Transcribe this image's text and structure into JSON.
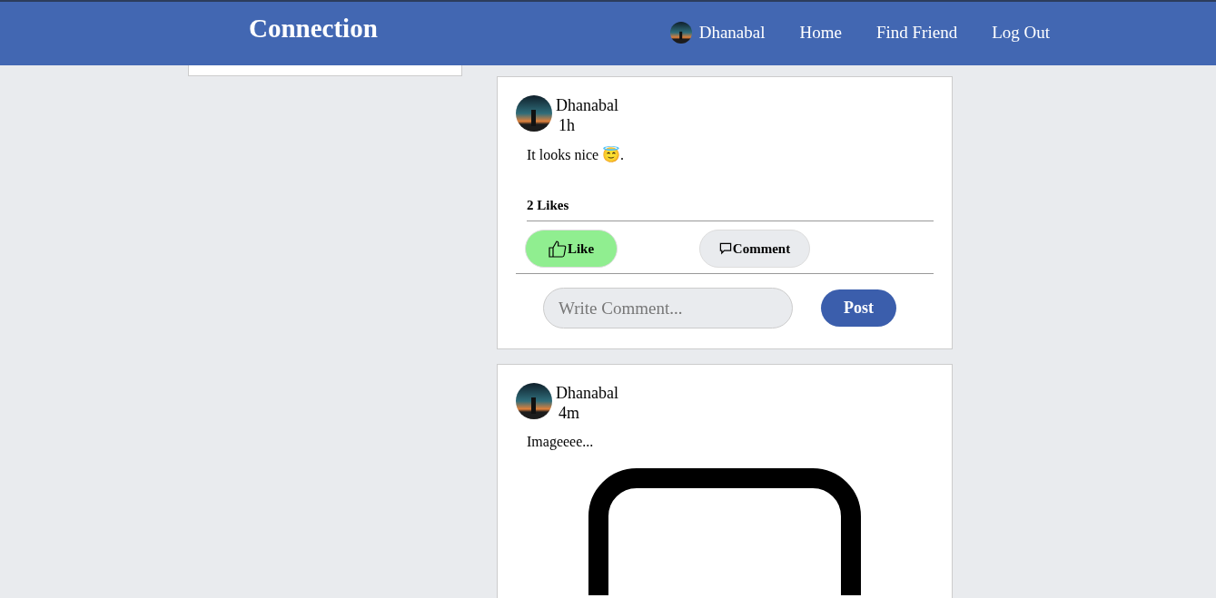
{
  "brand": "Connection",
  "nav": {
    "user": "Dhanabal",
    "links": [
      "Home",
      "Find Friend",
      "Log Out"
    ]
  },
  "posts": [
    {
      "author": "Dhanabal",
      "time": "1h",
      "text": "It looks nice 😇.",
      "likes": "2 Likes",
      "liked": true,
      "like_label": "Like",
      "comment_label": "Comment",
      "comment_placeholder": "Write Comment...",
      "post_label": "Post"
    },
    {
      "author": "Dhanabal",
      "time": "4m",
      "text": "Imageeee..."
    }
  ]
}
